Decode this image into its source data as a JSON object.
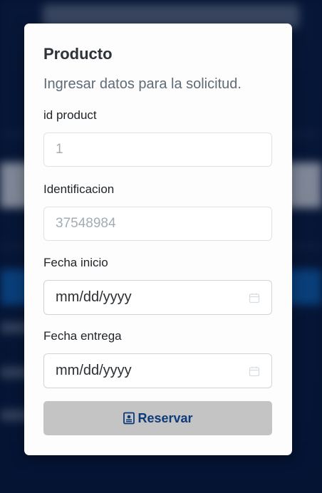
{
  "modal": {
    "title": "Producto",
    "subtitle": "Ingresar datos para la solicitud."
  },
  "form": {
    "fields": [
      {
        "label": "id product",
        "placeholder": "1"
      },
      {
        "label": "Identificacion",
        "placeholder": "37548984"
      },
      {
        "label": "Fecha inicio",
        "value": "mm/dd/yyyy"
      },
      {
        "label": "Fecha entrega",
        "value": "mm/dd/yyyy"
      }
    ],
    "submit": {
      "label": "Reservar",
      "icon": "id-card-icon"
    }
  },
  "colors": {
    "button_bg": "#c4c4c4",
    "button_text": "#0d3a78",
    "backdrop": "#06183a"
  }
}
